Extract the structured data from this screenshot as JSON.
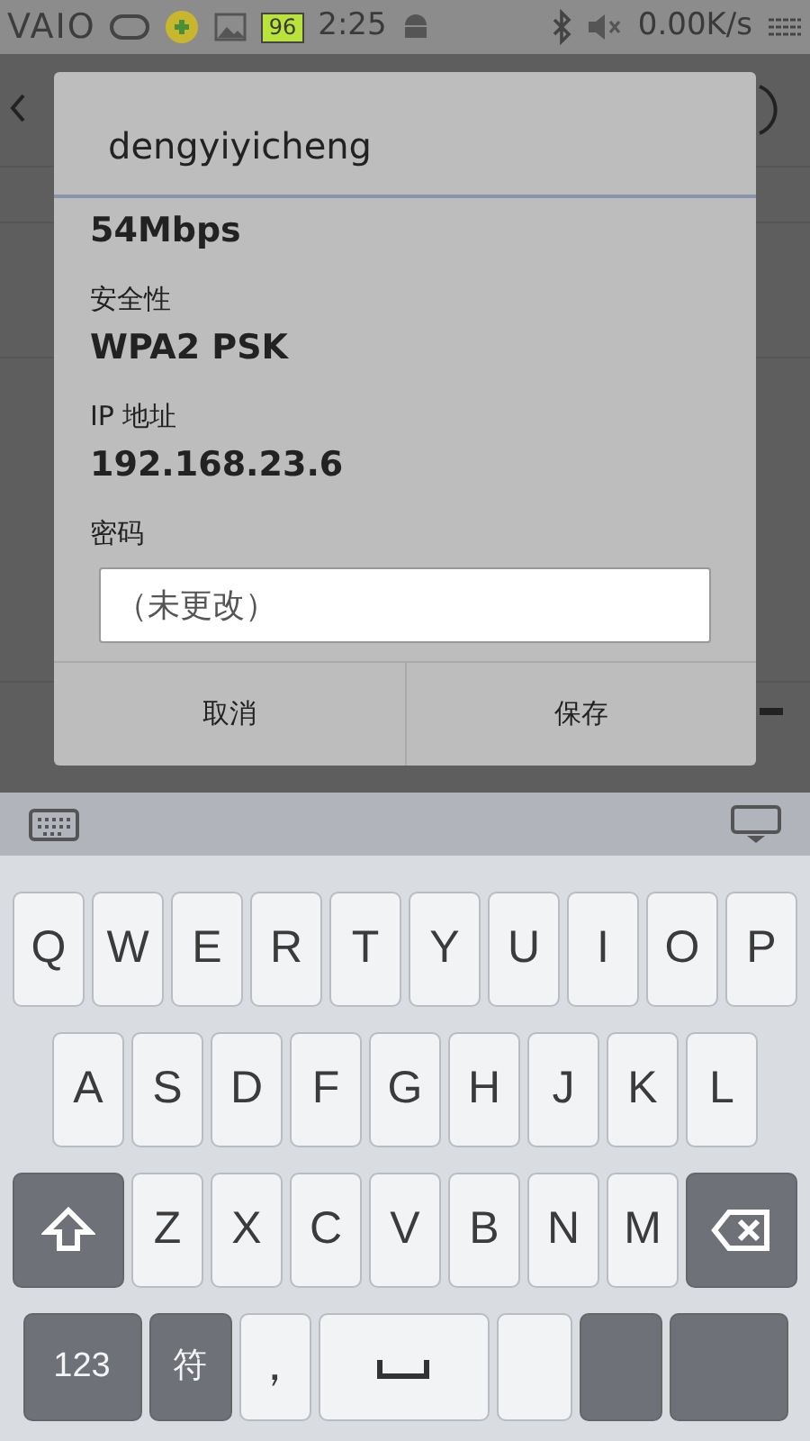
{
  "status_bar": {
    "logo": "VAIO",
    "battery": "96",
    "time": "2:25",
    "net_speed": "0.00K/s"
  },
  "dialog": {
    "title": "dengyiyicheng",
    "link_speed": "54Mbps",
    "fields": [
      {
        "label": "安全性",
        "value": "WPA2 PSK"
      },
      {
        "label": "IP 地址",
        "value": "192.168.23.6"
      }
    ],
    "password": {
      "label": "密码",
      "placeholder": "（未更改）"
    },
    "buttons": [
      "取消",
      "保存"
    ]
  },
  "keyboard": {
    "rows": [
      [
        {
          "kind": "letter",
          "label": "Q"
        },
        {
          "kind": "letter",
          "label": "W"
        },
        {
          "kind": "letter",
          "label": "E"
        },
        {
          "kind": "letter",
          "label": "R"
        },
        {
          "kind": "letter",
          "label": "T"
        },
        {
          "kind": "letter",
          "label": "Y"
        },
        {
          "kind": "letter",
          "label": "U"
        },
        {
          "kind": "letter",
          "label": "I"
        },
        {
          "kind": "letter",
          "label": "O"
        },
        {
          "kind": "letter",
          "label": "P"
        }
      ],
      [
        {
          "kind": "letter",
          "label": "A"
        },
        {
          "kind": "letter",
          "label": "S"
        },
        {
          "kind": "letter",
          "label": "D"
        },
        {
          "kind": "letter",
          "label": "F"
        },
        {
          "kind": "letter",
          "label": "G"
        },
        {
          "kind": "letter",
          "label": "H"
        },
        {
          "kind": "letter",
          "label": "J"
        },
        {
          "kind": "letter",
          "label": "K"
        },
        {
          "kind": "letter",
          "label": "L"
        }
      ],
      [
        {
          "kind": "shift"
        },
        {
          "kind": "letter",
          "label": "Z"
        },
        {
          "kind": "letter",
          "label": "X"
        },
        {
          "kind": "letter",
          "label": "C"
        },
        {
          "kind": "letter",
          "label": "V"
        },
        {
          "kind": "letter",
          "label": "B"
        },
        {
          "kind": "letter",
          "label": "N"
        },
        {
          "kind": "letter",
          "label": "M"
        },
        {
          "kind": "backspace"
        }
      ],
      [
        {
          "kind": "mode",
          "label": "123"
        },
        {
          "kind": "mode",
          "label": "符"
        },
        {
          "kind": "letter",
          "label": "，"
        },
        {
          "kind": "space"
        },
        {
          "kind": "blank"
        },
        {
          "kind": "darkblank"
        },
        {
          "kind": "darkblank"
        }
      ]
    ]
  }
}
